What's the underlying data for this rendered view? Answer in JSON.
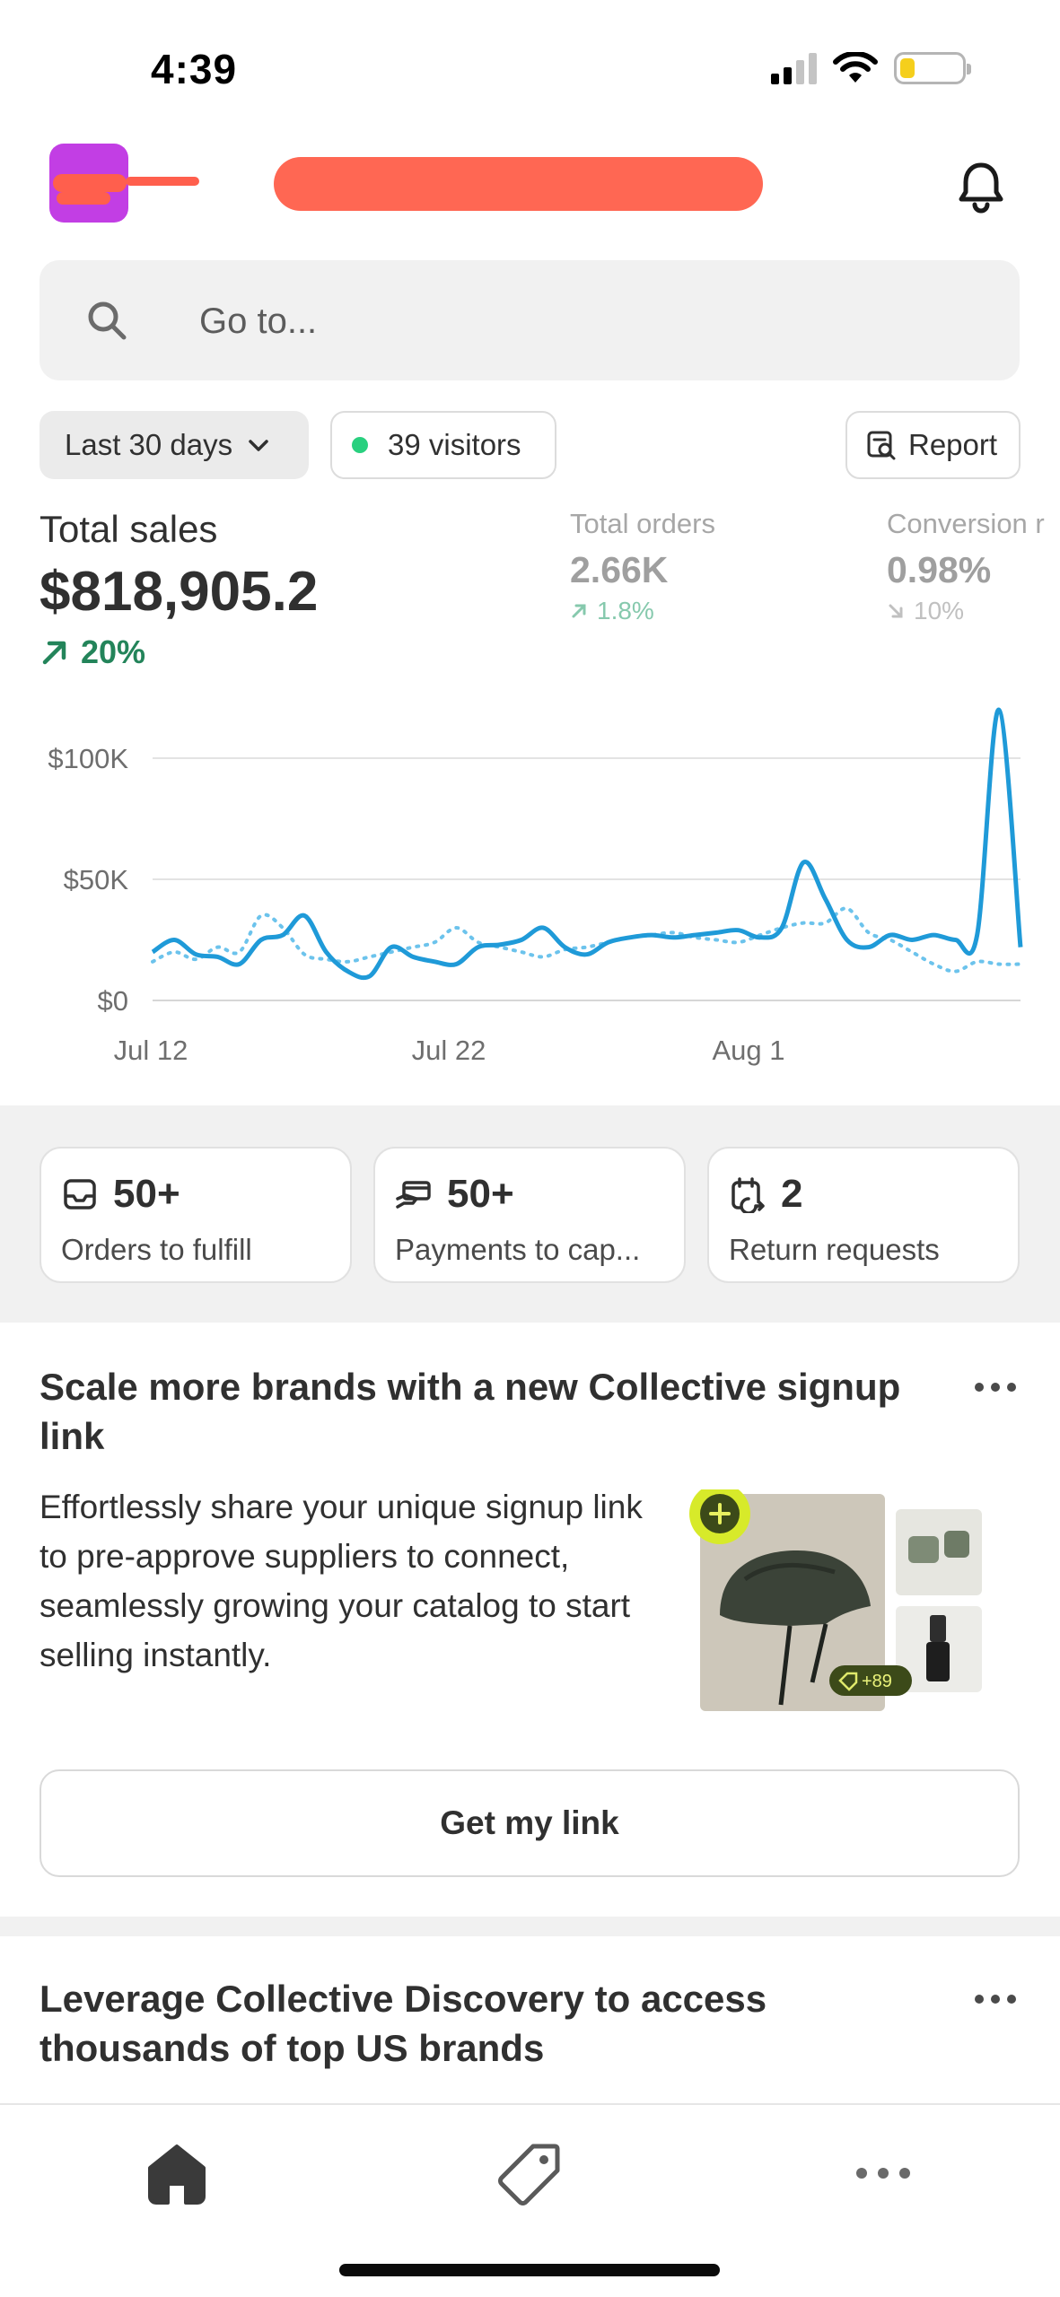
{
  "status_bar": {
    "time": "4:39"
  },
  "header": {
    "logo": "store-logo",
    "notification_icon": "bell-icon"
  },
  "search": {
    "placeholder": "Go to..."
  },
  "filters": {
    "date_range": "Last 30 days",
    "visitors": "39 visitors",
    "report_label": "Report"
  },
  "metrics": {
    "total_sales": {
      "label": "Total sales",
      "value": "$818,905.2",
      "delta": "20%"
    },
    "total_orders": {
      "label": "Total orders",
      "value": "2.66K",
      "delta": "1.8%"
    },
    "conversion": {
      "label": "Conversion r",
      "value": "0.98%",
      "delta": "10%"
    }
  },
  "chart_data": {
    "type": "line",
    "y_ticks": [
      "$100K",
      "$50K",
      "$0"
    ],
    "x_ticks": [
      "Jul 12",
      "Jul 22",
      "Aug 1"
    ],
    "ylim": [
      0,
      120000
    ],
    "grid": true,
    "series": [
      {
        "style": "solid",
        "color": "#1f9ad8",
        "values": [
          20000,
          25000,
          19000,
          18000,
          15000,
          25000,
          27000,
          35000,
          20000,
          12000,
          10000,
          22000,
          18000,
          16000,
          15000,
          22000,
          23000,
          25000,
          30000,
          22000,
          19000,
          24000,
          26000,
          27000,
          26000,
          27000,
          28000,
          29000,
          26000,
          30000,
          57000,
          42000,
          25000,
          22000,
          27000,
          25000,
          27000,
          25000,
          27000,
          120000,
          22000
        ]
      },
      {
        "style": "dotted",
        "color": "#6cc3ec",
        "values": [
          16000,
          20000,
          17000,
          22000,
          20000,
          35000,
          30000,
          19000,
          17000,
          16000,
          18000,
          20000,
          22000,
          24000,
          30000,
          24000,
          22000,
          20000,
          18000,
          21000,
          22000,
          24000,
          26000,
          27000,
          28000,
          26000,
          25000,
          24000,
          27000,
          30000,
          32000,
          32000,
          38000,
          28000,
          25000,
          20000,
          15000,
          12000,
          16000,
          15000,
          15000
        ]
      }
    ]
  },
  "tasks": [
    {
      "icon": "inbox-icon",
      "count": "50+",
      "label": "Orders to fulfill"
    },
    {
      "icon": "payment-hand-icon",
      "count": "50+",
      "label": "Payments to cap..."
    },
    {
      "icon": "return-icon",
      "count": "2",
      "label": "Return requests"
    }
  ],
  "promo": {
    "title": "Scale more brands with a new Collective signup link",
    "body": "Effortlessly share your unique signup link to pre-approve suppliers to connect, seamlessly growing your catalog to start selling instantly.",
    "image_tag": "+89",
    "button": "Get my link"
  },
  "promo2": {
    "title": "Leverage Collective Discovery to access thousands of top US brands"
  },
  "tabbar": {
    "items": [
      "home-icon",
      "tag-icon",
      "more-icon"
    ]
  },
  "colors": {
    "accent_green": "#23845a",
    "chart_blue": "#1f9ad8",
    "brand_purple": "#c23ee4",
    "redaction": "#ff6753"
  }
}
